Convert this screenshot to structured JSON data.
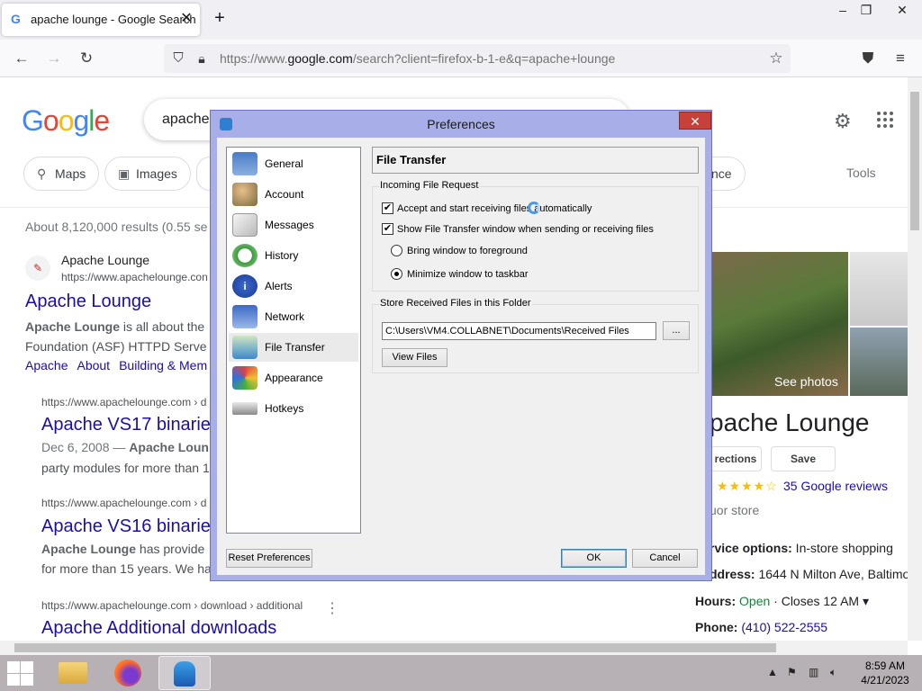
{
  "browser": {
    "tab_title": "apache lounge - Google Search",
    "tab_favicon": "G",
    "url_prefix": "https://www.",
    "url_domain": "google.com",
    "url_rest": "/search?client=firefox-b-1-e&q=apache+lounge"
  },
  "google": {
    "logo": [
      "G",
      "o",
      "o",
      "g",
      "l",
      "e"
    ],
    "logo_colors": [
      "#4285f4",
      "#ea4335",
      "#fbbc05",
      "#4285f4",
      "#34a853",
      "#ea4335"
    ],
    "query": "apache",
    "chips": [
      "Maps",
      "Images"
    ],
    "chip_partial": "nce",
    "tools": "Tools",
    "stats": "About 8,120,000 results (0.55 se",
    "result1": {
      "site": "Apache Lounge",
      "url": "https://www.apachelounge.con",
      "title": "Apache Lounge",
      "snip1_bold": "Apache Lounge",
      "snip1_rest": " is all about the",
      "snip2": "Foundation (ASF) HTTPD Serve",
      "sublinks": [
        "Apache",
        "About",
        "Building & Mem"
      ]
    },
    "result2": {
      "url": "https://www.apachelounge.com › d",
      "title": "Apache VS17 binarie",
      "date": "Dec 6, 2008 — ",
      "snip_bold": "Apache Loun",
      "snip2": "party modules for more than 1"
    },
    "result3": {
      "url": "https://www.apachelounge.com › d",
      "title": "Apache VS16 binarie",
      "snip_bold": "Apache Lounge",
      "snip_rest": " has provide",
      "snip2": "for more than 15 years. We ha"
    },
    "result4": {
      "url": "https://www.apachelounge.com › download › additional",
      "title": "Apache Additional downloads"
    },
    "kp": {
      "see_photos": "See photos",
      "title": "pache Lounge",
      "btn_directions": "rections",
      "btn_save": "Save",
      "stars": "★★★★☆",
      "reviews": "35 Google reviews",
      "category": "uor store",
      "service_label": "rvice options:",
      "service_value": " In-store shopping",
      "address_label": "ddress:",
      "address_value": " 1644 N Milton Ave, Baltimo",
      "hours_label": "Hours:",
      "hours_open": "Open",
      "hours_rest": " · Closes 12 AM ▾",
      "phone_label": "Phone:",
      "phone_value": "(410) 522-2555"
    }
  },
  "dialog": {
    "title": "Preferences",
    "close": "✕",
    "categories": [
      "General",
      "Account",
      "Messages",
      "History",
      "Alerts",
      "Network",
      "File Transfer",
      "Appearance",
      "Hotkeys"
    ],
    "selected_category": "File Transfer",
    "panel_title": "File Transfer",
    "incoming_group": "Incoming File Request",
    "opt_accept": "Accept and start receiving files automatically",
    "opt_show": "Show File Transfer window when sending or receiving files",
    "opt_bring": "Bring window to foreground",
    "opt_minimize": "Minimize window to taskbar",
    "store_group": "Store Received Files in this Folder",
    "folder_path": "C:\\Users\\VM4.COLLABNET\\Documents\\Received Files",
    "browse": "...",
    "view_files": "View Files",
    "reset": "Reset Preferences",
    "ok": "OK",
    "cancel": "Cancel"
  },
  "taskbar": {
    "time": "8:59 AM",
    "date": "4/21/2023"
  }
}
